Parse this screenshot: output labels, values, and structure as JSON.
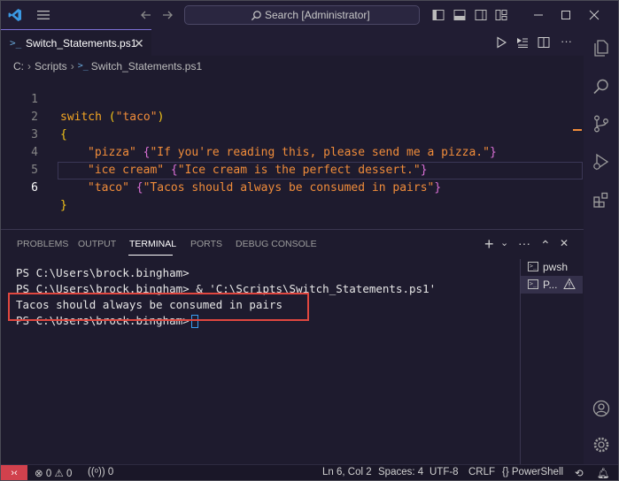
{
  "titlebar": {
    "search_text": "Search [Administrator]"
  },
  "editor_tab": {
    "label": "Switch_Statements.ps1",
    "close": "✕"
  },
  "breadcrumb": {
    "drive": "C:",
    "folder": "Scripts",
    "file": "Switch_Statements.ps1",
    "sep": "›"
  },
  "code": {
    "lines": [
      {
        "num": "1",
        "parts": [
          "switch",
          " ",
          "(",
          "\"taco\"",
          ")"
        ]
      },
      {
        "num": "2",
        "text": "{"
      },
      {
        "num": "3",
        "key": "\"pizza\"",
        "open": "{",
        "value": "\"If you're reading this, please send me a pizza.\"",
        "close": "}"
      },
      {
        "num": "4",
        "key": "\"ice cream\"",
        "open": "{",
        "value": "\"Ice cream is the perfect dessert.\"",
        "close": "}"
      },
      {
        "num": "5",
        "key": "\"taco\"",
        "open": "{",
        "value": "\"Tacos should always be consumed in pairs\"",
        "close": "}"
      },
      {
        "num": "6",
        "text": "}"
      }
    ],
    "active_line": 6
  },
  "panel": {
    "tabs": [
      "PROBLEMS",
      "OUTPUT",
      "TERMINAL",
      "PORTS",
      "DEBUG CONSOLE"
    ],
    "active_tab": "TERMINAL",
    "actions": {
      "add": "+",
      "dropdown": "⌄",
      "more": "···",
      "maximize": "⌃",
      "close": "✕"
    }
  },
  "terminal": {
    "lines": [
      "PS C:\\Users\\brock.bingham>",
      "PS C:\\Users\\brock.bingham> & 'C:\\Scripts\\Switch_Statements.ps1'",
      "Tacos should always be consumed in pairs",
      "PS C:\\Users\\brock.bingham>"
    ],
    "sessions": [
      {
        "label": "pwsh",
        "selected": false
      },
      {
        "label": "P...",
        "selected": true,
        "warning": true
      }
    ]
  },
  "statusbar": {
    "errors": "0",
    "warnings": "0",
    "ports": "0",
    "position": "Ln 6, Col 2",
    "spaces": "Spaces: 4",
    "encoding": "UTF-8",
    "eol": "CRLF",
    "language": "PowerShell",
    "language_braces": "{}"
  },
  "colors": {
    "keyword": "#f5a623",
    "string": "#f08c3a",
    "bracket_outer": "#f5c518",
    "bracket_inner": "#da70d6",
    "highlight_box": "#e0473f",
    "remote_indicator": "#d1414d"
  },
  "icons": {
    "titlebar": [
      "vscode-logo-icon",
      "hamburger-menu-icon",
      "back-arrow-icon",
      "forward-arrow-icon",
      "search-icon",
      "toggle-sidebar-icon",
      "toggle-panel-icon",
      "toggle-secondary-sidebar-icon",
      "customize-layout-icon",
      "minimize-icon",
      "maximize-icon",
      "close-icon"
    ],
    "activity": [
      "explorer-icon",
      "search-icon",
      "source-control-icon",
      "run-debug-icon",
      "extensions-icon",
      "account-icon",
      "settings-gear-icon"
    ]
  }
}
